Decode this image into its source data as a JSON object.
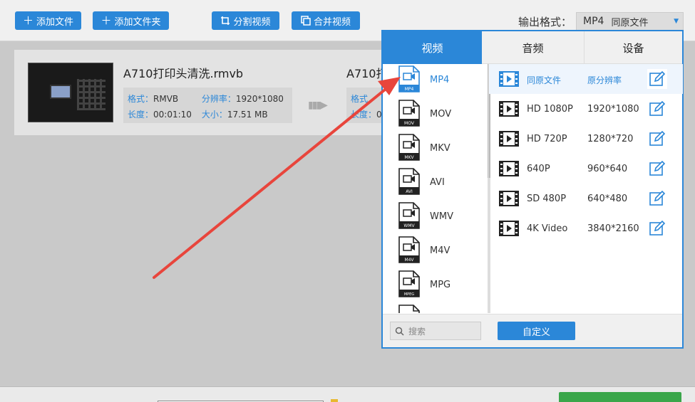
{
  "toolbar": {
    "add_file": "添加文件",
    "add_folder": "添加文件夹",
    "split_video": "分割视频",
    "merge_video": "合并视频",
    "output_label": "输出格式：",
    "output_format": "MP4",
    "output_quality": "同原文件"
  },
  "file": {
    "name": "A710打印头清洗.rmvb",
    "output_name": "A710打",
    "format_key": "格式：",
    "format_val": "RMVB",
    "resolution_key": "分辨率：",
    "resolution_val": "1920*1080",
    "duration_key": "长度：",
    "duration_val": "00:01:10",
    "size_key": "大小：",
    "size_val": "17.51 MB",
    "out_format_key": "格式",
    "out_duration_key": "长度：",
    "out_duration_partial": "0"
  },
  "panel": {
    "tabs": [
      "视频",
      "音频",
      "设备"
    ],
    "formats": [
      {
        "label": "MP4",
        "tag": "MP4"
      },
      {
        "label": "MOV",
        "tag": "MOV"
      },
      {
        "label": "MKV",
        "tag": "MKV"
      },
      {
        "label": "AVI",
        "tag": "AVI"
      },
      {
        "label": "WMV",
        "tag": "WMV"
      },
      {
        "label": "M4V",
        "tag": "M4V"
      },
      {
        "label": "MPG",
        "tag": "MPEG"
      }
    ],
    "resolutions": [
      {
        "name": "同原文件",
        "size": "原分辨率"
      },
      {
        "name": "HD 1080P",
        "size": "1920*1080"
      },
      {
        "name": "HD 720P",
        "size": "1280*720"
      },
      {
        "name": "640P",
        "size": "960*640"
      },
      {
        "name": "SD 480P",
        "size": "640*480"
      },
      {
        "name": "4K Video",
        "size": "3840*2160"
      }
    ],
    "search_placeholder": "搜索",
    "custom_button": "自定义"
  },
  "colors": {
    "accent": "#2b87d8",
    "annotation_arrow": "#e8453c",
    "start_button": "#3aa64a"
  }
}
